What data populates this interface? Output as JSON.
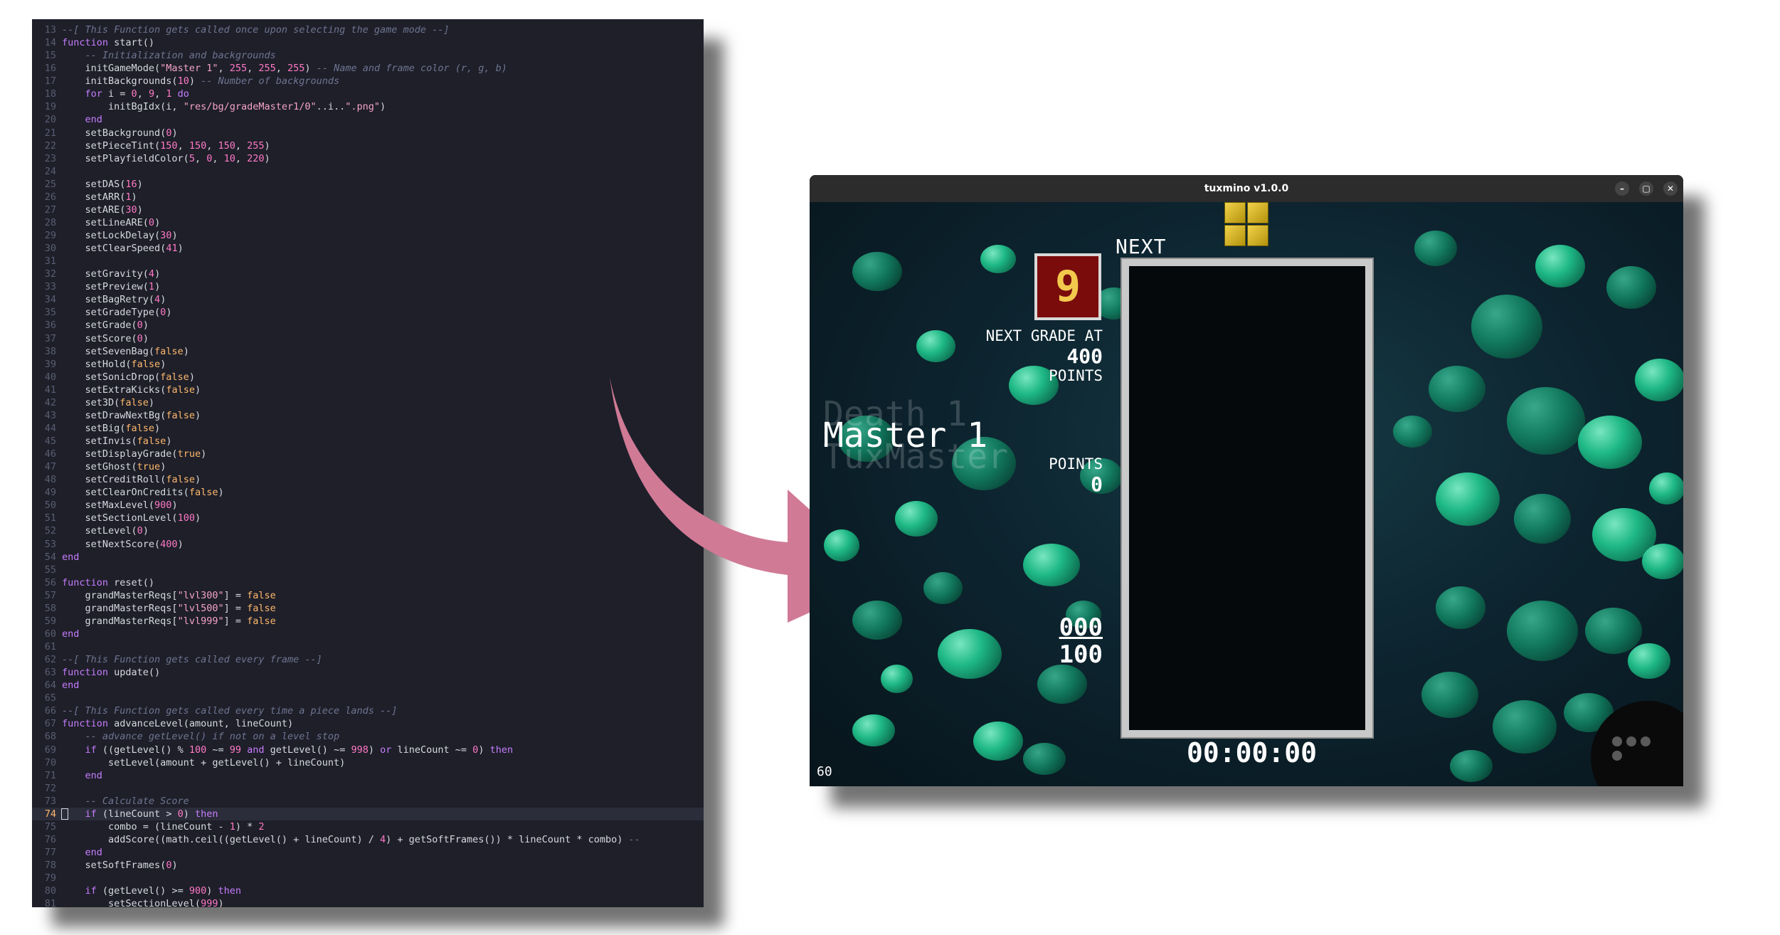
{
  "editor": {
    "active_line": 74,
    "lines": [
      {
        "n": 13,
        "t": [
          [
            "--[ This Function gets called once upon selecting the game mode --]",
            "cm"
          ]
        ]
      },
      {
        "n": 14,
        "t": [
          [
            "function",
            "kw"
          ],
          [
            " start()",
            ""
          ]
        ]
      },
      {
        "n": 15,
        "t": [
          [
            "    -- Initialization and backgrounds",
            "cm"
          ]
        ]
      },
      {
        "n": 16,
        "t": [
          [
            "    initGameMode(",
            ""
          ],
          [
            "\"Master 1\"",
            "st"
          ],
          [
            ", ",
            ""
          ],
          [
            "255",
            "nm"
          ],
          [
            ", ",
            ""
          ],
          [
            "255",
            "nm"
          ],
          [
            ", ",
            ""
          ],
          [
            "255",
            "nm"
          ],
          [
            ") ",
            ""
          ],
          [
            "-- Name and frame color (r, g, b)",
            "cm"
          ]
        ]
      },
      {
        "n": 17,
        "t": [
          [
            "    initBackgrounds(",
            ""
          ],
          [
            "10",
            "nm"
          ],
          [
            ") ",
            ""
          ],
          [
            "-- Number of backgrounds",
            "cm"
          ]
        ]
      },
      {
        "n": 18,
        "t": [
          [
            "    ",
            ""
          ],
          [
            "for",
            "kw"
          ],
          [
            " i = ",
            ""
          ],
          [
            "0",
            "nm"
          ],
          [
            ", ",
            ""
          ],
          [
            "9",
            "nm"
          ],
          [
            ", ",
            ""
          ],
          [
            "1",
            "nm"
          ],
          [
            " ",
            ""
          ],
          [
            "do",
            "kw"
          ]
        ]
      },
      {
        "n": 19,
        "t": [
          [
            "        initBgIdx(i, ",
            ""
          ],
          [
            "\"res/bg/gradeMaster1/0\"",
            "st"
          ],
          [
            "..i..",
            ""
          ],
          [
            "\".png\"",
            "st"
          ],
          [
            ")",
            ""
          ]
        ]
      },
      {
        "n": 20,
        "t": [
          [
            "    ",
            ""
          ],
          [
            "end",
            "kw"
          ]
        ]
      },
      {
        "n": 21,
        "t": [
          [
            "    setBackground(",
            ""
          ],
          [
            "0",
            "nm"
          ],
          [
            ")",
            ""
          ]
        ]
      },
      {
        "n": 22,
        "t": [
          [
            "    setPieceTint(",
            ""
          ],
          [
            "150",
            "nm"
          ],
          [
            ", ",
            ""
          ],
          [
            "150",
            "nm"
          ],
          [
            ", ",
            ""
          ],
          [
            "150",
            "nm"
          ],
          [
            ", ",
            ""
          ],
          [
            "255",
            "nm"
          ],
          [
            ")",
            ""
          ]
        ]
      },
      {
        "n": 23,
        "t": [
          [
            "    setPlayfieldColor(",
            ""
          ],
          [
            "5",
            "nm"
          ],
          [
            ", ",
            ""
          ],
          [
            "0",
            "nm"
          ],
          [
            ", ",
            ""
          ],
          [
            "10",
            "nm"
          ],
          [
            ", ",
            ""
          ],
          [
            "220",
            "nm"
          ],
          [
            ")",
            ""
          ]
        ]
      },
      {
        "n": 24,
        "t": [
          [
            "",
            ""
          ]
        ]
      },
      {
        "n": 25,
        "t": [
          [
            "    setDAS(",
            ""
          ],
          [
            "16",
            "nm"
          ],
          [
            ")",
            ""
          ]
        ]
      },
      {
        "n": 26,
        "t": [
          [
            "    setARR(",
            ""
          ],
          [
            "1",
            "nm"
          ],
          [
            ")",
            ""
          ]
        ]
      },
      {
        "n": 27,
        "t": [
          [
            "    setARE(",
            ""
          ],
          [
            "30",
            "nm"
          ],
          [
            ")",
            ""
          ]
        ]
      },
      {
        "n": 28,
        "t": [
          [
            "    setLineARE(",
            ""
          ],
          [
            "0",
            "nm"
          ],
          [
            ")",
            ""
          ]
        ]
      },
      {
        "n": 29,
        "t": [
          [
            "    setLockDelay(",
            ""
          ],
          [
            "30",
            "nm"
          ],
          [
            ")",
            ""
          ]
        ]
      },
      {
        "n": 30,
        "t": [
          [
            "    setClearSpeed(",
            ""
          ],
          [
            "41",
            "nm"
          ],
          [
            ")",
            ""
          ]
        ]
      },
      {
        "n": 31,
        "t": [
          [
            "",
            ""
          ]
        ]
      },
      {
        "n": 32,
        "t": [
          [
            "    setGravity(",
            ""
          ],
          [
            "4",
            "nm"
          ],
          [
            ")",
            ""
          ]
        ]
      },
      {
        "n": 33,
        "t": [
          [
            "    setPreview(",
            ""
          ],
          [
            "1",
            "nm"
          ],
          [
            ")",
            ""
          ]
        ]
      },
      {
        "n": 34,
        "t": [
          [
            "    setBagRetry(",
            ""
          ],
          [
            "4",
            "nm"
          ],
          [
            ")",
            ""
          ]
        ]
      },
      {
        "n": 35,
        "t": [
          [
            "    setGradeType(",
            ""
          ],
          [
            "0",
            "nm"
          ],
          [
            ")",
            ""
          ]
        ]
      },
      {
        "n": 36,
        "t": [
          [
            "    setGrade(",
            ""
          ],
          [
            "0",
            "nm"
          ],
          [
            ")",
            ""
          ]
        ]
      },
      {
        "n": 37,
        "t": [
          [
            "    setScore(",
            ""
          ],
          [
            "0",
            "nm"
          ],
          [
            ")",
            ""
          ]
        ]
      },
      {
        "n": 38,
        "t": [
          [
            "    setSevenBag(",
            ""
          ],
          [
            "false",
            "bo"
          ],
          [
            ")",
            ""
          ]
        ]
      },
      {
        "n": 39,
        "t": [
          [
            "    setHold(",
            ""
          ],
          [
            "false",
            "bo"
          ],
          [
            ")",
            ""
          ]
        ]
      },
      {
        "n": 40,
        "t": [
          [
            "    setSonicDrop(",
            ""
          ],
          [
            "false",
            "bo"
          ],
          [
            ")",
            ""
          ]
        ]
      },
      {
        "n": 41,
        "t": [
          [
            "    setExtraKicks(",
            ""
          ],
          [
            "false",
            "bo"
          ],
          [
            ")",
            ""
          ]
        ]
      },
      {
        "n": 42,
        "t": [
          [
            "    set3D(",
            ""
          ],
          [
            "false",
            "bo"
          ],
          [
            ")",
            ""
          ]
        ]
      },
      {
        "n": 43,
        "t": [
          [
            "    setDrawNextBg(",
            ""
          ],
          [
            "false",
            "bo"
          ],
          [
            ")",
            ""
          ]
        ]
      },
      {
        "n": 44,
        "t": [
          [
            "    setBig(",
            ""
          ],
          [
            "false",
            "bo"
          ],
          [
            ")",
            ""
          ]
        ]
      },
      {
        "n": 45,
        "t": [
          [
            "    setInvis(",
            ""
          ],
          [
            "false",
            "bo"
          ],
          [
            ")",
            ""
          ]
        ]
      },
      {
        "n": 46,
        "t": [
          [
            "    setDisplayGrade(",
            ""
          ],
          [
            "true",
            "bo"
          ],
          [
            ")",
            ""
          ]
        ]
      },
      {
        "n": 47,
        "t": [
          [
            "    setGhost(",
            ""
          ],
          [
            "true",
            "bo"
          ],
          [
            ")",
            ""
          ]
        ]
      },
      {
        "n": 48,
        "t": [
          [
            "    setCreditRoll(",
            ""
          ],
          [
            "false",
            "bo"
          ],
          [
            ")",
            ""
          ]
        ]
      },
      {
        "n": 49,
        "t": [
          [
            "    setClearOnCredits(",
            ""
          ],
          [
            "false",
            "bo"
          ],
          [
            ")",
            ""
          ]
        ]
      },
      {
        "n": 50,
        "t": [
          [
            "    setMaxLevel(",
            ""
          ],
          [
            "900",
            "nm"
          ],
          [
            ")",
            ""
          ]
        ]
      },
      {
        "n": 51,
        "t": [
          [
            "    setSectionLevel(",
            ""
          ],
          [
            "100",
            "nm"
          ],
          [
            ")",
            ""
          ]
        ]
      },
      {
        "n": 52,
        "t": [
          [
            "    setLevel(",
            ""
          ],
          [
            "0",
            "nm"
          ],
          [
            ")",
            ""
          ]
        ]
      },
      {
        "n": 53,
        "t": [
          [
            "    setNextScore(",
            ""
          ],
          [
            "400",
            "nm"
          ],
          [
            ")",
            ""
          ]
        ]
      },
      {
        "n": 54,
        "t": [
          [
            "end",
            "kw"
          ]
        ]
      },
      {
        "n": 55,
        "t": [
          [
            "",
            ""
          ]
        ]
      },
      {
        "n": 56,
        "t": [
          [
            "function",
            "kw"
          ],
          [
            " reset()",
            ""
          ]
        ]
      },
      {
        "n": 57,
        "t": [
          [
            "    grandMasterReqs[",
            ""
          ],
          [
            "\"lvl300\"",
            "st"
          ],
          [
            "] = ",
            ""
          ],
          [
            "false",
            "bo"
          ]
        ]
      },
      {
        "n": 58,
        "t": [
          [
            "    grandMasterReqs[",
            ""
          ],
          [
            "\"lvl500\"",
            "st"
          ],
          [
            "] = ",
            ""
          ],
          [
            "false",
            "bo"
          ]
        ]
      },
      {
        "n": 59,
        "t": [
          [
            "    grandMasterReqs[",
            ""
          ],
          [
            "\"lvl999\"",
            "st"
          ],
          [
            "] = ",
            ""
          ],
          [
            "false",
            "bo"
          ]
        ]
      },
      {
        "n": 60,
        "t": [
          [
            "end",
            "kw"
          ]
        ]
      },
      {
        "n": 61,
        "t": [
          [
            "",
            ""
          ]
        ]
      },
      {
        "n": 62,
        "t": [
          [
            "--[ This Function gets called every frame --]",
            "cm"
          ]
        ]
      },
      {
        "n": 63,
        "t": [
          [
            "function",
            "kw"
          ],
          [
            " update()",
            ""
          ]
        ]
      },
      {
        "n": 64,
        "t": [
          [
            "end",
            "kw"
          ]
        ]
      },
      {
        "n": 65,
        "t": [
          [
            "",
            ""
          ]
        ]
      },
      {
        "n": 66,
        "t": [
          [
            "--[ This Function gets called every time a piece lands --]",
            "cm"
          ]
        ]
      },
      {
        "n": 67,
        "t": [
          [
            "function",
            "kw"
          ],
          [
            " advanceLevel(amount, lineCount)",
            ""
          ]
        ]
      },
      {
        "n": 68,
        "t": [
          [
            "    -- advance getLevel() if not on a level stop",
            "cm"
          ]
        ]
      },
      {
        "n": 69,
        "t": [
          [
            "    ",
            ""
          ],
          [
            "if",
            "kw"
          ],
          [
            " ((getLevel() % ",
            ""
          ],
          [
            "100",
            "nm"
          ],
          [
            " ~= ",
            ""
          ],
          [
            "99",
            "nm"
          ],
          [
            " ",
            ""
          ],
          [
            "and",
            "kw"
          ],
          [
            " getLevel() ~= ",
            ""
          ],
          [
            "998",
            "nm"
          ],
          [
            ") ",
            ""
          ],
          [
            "or",
            "kw"
          ],
          [
            " lineCount ~= ",
            ""
          ],
          [
            "0",
            "nm"
          ],
          [
            ") ",
            ""
          ],
          [
            "then",
            "kw"
          ]
        ]
      },
      {
        "n": 70,
        "t": [
          [
            "        setLevel(amount + getLevel() + lineCount)",
            ""
          ]
        ]
      },
      {
        "n": 71,
        "t": [
          [
            "    ",
            ""
          ],
          [
            "end",
            "kw"
          ]
        ]
      },
      {
        "n": 72,
        "t": [
          [
            "",
            ""
          ]
        ]
      },
      {
        "n": 73,
        "t": [
          [
            "    -- Calculate Score",
            "cm"
          ]
        ]
      },
      {
        "n": 74,
        "t": [
          [
            "    ",
            ""
          ],
          [
            "if",
            "kw"
          ],
          [
            " (lineCount > ",
            ""
          ],
          [
            "0",
            "nm"
          ],
          [
            ") ",
            ""
          ],
          [
            "then",
            "kw"
          ]
        ]
      },
      {
        "n": 75,
        "t": [
          [
            "        combo = (lineCount - ",
            ""
          ],
          [
            "1",
            "nm"
          ],
          [
            ") * ",
            ""
          ],
          [
            "2",
            "nm"
          ]
        ]
      },
      {
        "n": 76,
        "t": [
          [
            "        addScore((math.ceil((getLevel() + lineCount) / ",
            ""
          ],
          [
            "4",
            "nm"
          ],
          [
            ") + getSoftFrames()) * lineCount * combo) ",
            ""
          ],
          [
            "--",
            "cm"
          ]
        ]
      },
      {
        "n": 77,
        "t": [
          [
            "    ",
            ""
          ],
          [
            "end",
            "kw"
          ]
        ]
      },
      {
        "n": 78,
        "t": [
          [
            "    setSoftFrames(",
            ""
          ],
          [
            "0",
            "nm"
          ],
          [
            ")",
            ""
          ]
        ]
      },
      {
        "n": 79,
        "t": [
          [
            "",
            ""
          ]
        ]
      },
      {
        "n": 80,
        "t": [
          [
            "    ",
            ""
          ],
          [
            "if",
            "kw"
          ],
          [
            " (getLevel() >= ",
            ""
          ],
          [
            "900",
            "nm"
          ],
          [
            ") ",
            ""
          ],
          [
            "then",
            "kw"
          ]
        ]
      },
      {
        "n": 81,
        "t": [
          [
            "        setSectionLevel(",
            ""
          ],
          [
            "999",
            "nm"
          ],
          [
            ")",
            ""
          ]
        ]
      }
    ]
  },
  "arrow": {
    "color": "#d07a96"
  },
  "window": {
    "title": "tuxmino v1.0.0",
    "controls": {
      "minimize": "–",
      "maximize": "▢",
      "close": "✕"
    }
  },
  "game": {
    "next_label": "NEXT",
    "grade": "9",
    "next_grade_label": "NEXT GRADE AT",
    "next_grade_value": "400",
    "next_grade_unit": "POINTS",
    "points_label": "POINTS",
    "points_value": "0",
    "mode_above": "Death 1",
    "mode_current": "Master 1",
    "mode_below": "TuxMaster",
    "level_current": "000",
    "level_section": "100",
    "timer": "00:00:00",
    "fps": "60"
  }
}
